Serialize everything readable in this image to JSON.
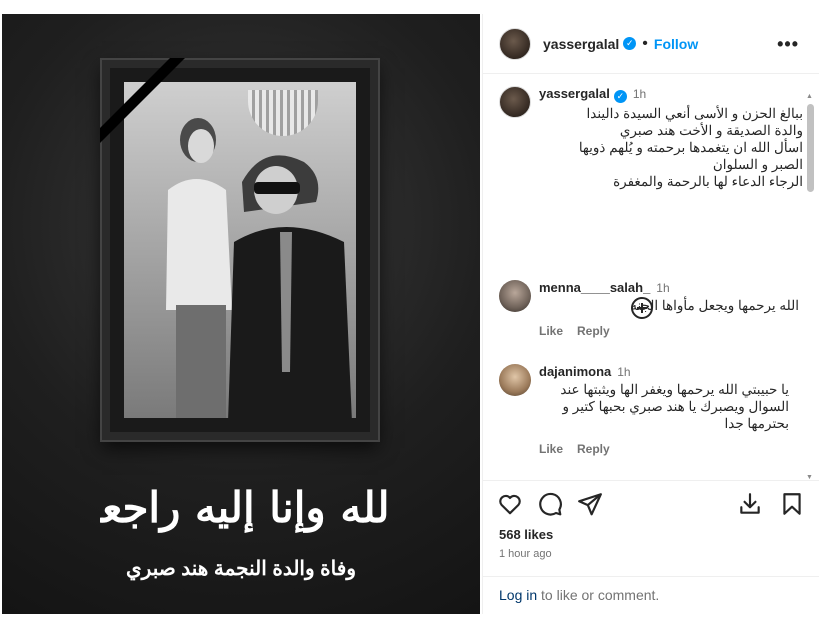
{
  "post": {
    "username": "yassergalal",
    "follow_label": "Follow",
    "more_label": "•••",
    "media_subtitle": "وفاة والدة النجمة هند صبري",
    "media_calligraphy": "إنا لله وإنا إليه راجعون"
  },
  "caption": {
    "username": "yassergalal",
    "time": "1h",
    "lines": [
      "ببالغ الحزن و الأسى أنعي السيدة داليندا",
      "والدة الصديقة و الأخت هند صبري",
      "اسأل الله ان يتغمدها برحمته و يُلهم ذويها",
      "الصبر و السلوان",
      "الرجاء الدعاء لها بالرحمة والمغفرة"
    ]
  },
  "comments": [
    {
      "username": "menna____salah_",
      "time": "1h",
      "text": "الله يرحمها ويجعل مأواها الجنه",
      "like_label": "Like",
      "reply_label": "Reply"
    },
    {
      "username": "dajanimona",
      "time": "1h",
      "text_lines": [
        "يا حبيبتي الله يرحمها ويغفر الها ويثبتها عند",
        "السوال ويصبرك يا هند صبري بحبها كتير و",
        "بحترمها جدا"
      ],
      "like_label": "Like",
      "reply_label": "Reply"
    }
  ],
  "stats": {
    "likes": "568 likes",
    "time_ago": "1 hour ago"
  },
  "login": {
    "link": "Log in",
    "rest": " to like or comment."
  },
  "colors": {
    "accent": "#0095f6",
    "muted": "#737373",
    "link_dark": "#00376b"
  }
}
